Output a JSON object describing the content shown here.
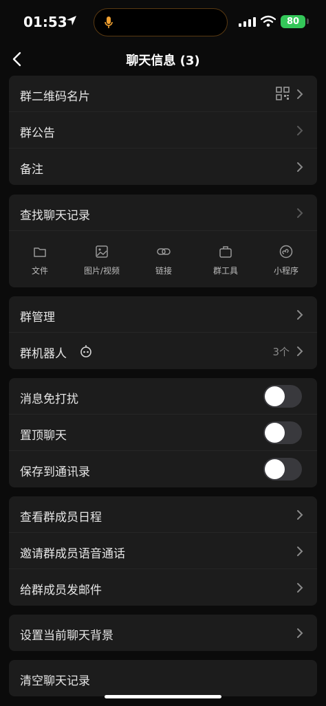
{
  "status": {
    "time": "01:53",
    "battery": "80"
  },
  "nav": {
    "title": "聊天信息 (3)"
  },
  "group1": {
    "qr_card": "群二维码名片",
    "announcement": "群公告",
    "remark": "备注"
  },
  "search": {
    "label": "查找聊天记录",
    "tools": [
      "文件",
      "图片/视频",
      "链接",
      "群工具",
      "小程序"
    ]
  },
  "group3": {
    "manage": "群管理",
    "robots": "群机器人",
    "robots_count": "3个"
  },
  "toggles": {
    "mute": "消息免打扰",
    "pin": "置顶聊天",
    "save_contacts": "保存到通讯录"
  },
  "group5": {
    "schedule": "查看群成员日程",
    "voice_call": "邀请群成员语音通话",
    "mail": "给群成员发邮件"
  },
  "background": {
    "label": "设置当前聊天背景"
  },
  "clear": {
    "label": "清空聊天记录"
  },
  "colors": {
    "background": "#0b0b0b",
    "card": "#1c1c1c",
    "battery": "#34c759",
    "toggle_off": "#39393d"
  }
}
